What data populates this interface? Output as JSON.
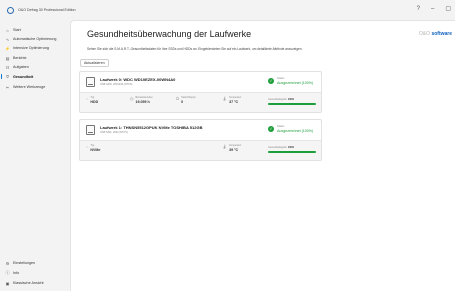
{
  "window": {
    "title": "O&O Defrag 30 Professional Edition",
    "controls": {
      "help": "?",
      "minimize": "–",
      "restore": "▢"
    }
  },
  "sidebar": {
    "items": [
      {
        "label": "Start",
        "icon": "home-icon",
        "glyph": "⌂",
        "active": false
      },
      {
        "label": "Automatische Optimierung",
        "icon": "wave-icon",
        "glyph": "∿",
        "active": false
      },
      {
        "label": "Intensive Optimierung",
        "icon": "lightning-icon",
        "glyph": "⚡",
        "active": false
      },
      {
        "label": "Berichte",
        "icon": "chart-icon",
        "glyph": "▤",
        "active": false
      },
      {
        "label": "Aufgaben",
        "icon": "clipboard-icon",
        "glyph": "☷",
        "active": false
      },
      {
        "label": "Gesundheit",
        "icon": "heart-pulse-icon",
        "glyph": "♡",
        "active": true
      },
      {
        "label": "Weitere Werkzeuge",
        "icon": "tools-icon",
        "glyph": "✂",
        "active": false
      }
    ],
    "bottom_items": [
      {
        "label": "Einstellungen",
        "icon": "gear-icon",
        "glyph": "⚙"
      },
      {
        "label": "Info",
        "icon": "info-icon",
        "glyph": "ⓘ"
      },
      {
        "label": "Klassische Ansicht",
        "icon": "classic-view-icon",
        "glyph": "▣"
      }
    ]
  },
  "main": {
    "title": "Gesundheitsüberwachung der Laufwerke",
    "brand_prefix": "O&O",
    "brand_name": "software",
    "description": "Sehen Sie sich die S.M.A.R.T.-Gesundheitsdaten für Ihre SSDs und HDDs an. Eingeblendeten Sie auf ein Laufwerk, um detaillierte Attribute anzuzeigen.",
    "refresh_label": "Aktualisieren"
  },
  "drives": [
    {
      "name": "Laufwerk 0: WDC WD10EZEX-00WN4A0",
      "sub": "USB HDD, WD1234 (NTFS)",
      "status_label": "Status",
      "status_value": "Ausgezeichnet (100%)",
      "metrics": [
        {
          "label": "Typ",
          "value": "HDD",
          "icon": "disk-type-icon"
        },
        {
          "label": "Betriebsstunden",
          "value": "19.059 h",
          "icon": "clock-icon"
        },
        {
          "label": "Starts/Stopps",
          "value": "0",
          "icon": "power-icon"
        },
        {
          "label": "Temperatur",
          "value": "37 °C",
          "icon": "thermometer-icon"
        }
      ],
      "health_label": "Gesundheitsgrad:",
      "health_value": "100%",
      "health_percent": 100
    },
    {
      "name": "Laufwerk 1: THNSN5512GPUK NVMe TOSHIBA 512GB",
      "sub": "USB SSD, 2022 (NTFS)",
      "status_label": "Status",
      "status_value": "Ausgezeichnet (100%)",
      "metrics": [
        {
          "label": "Typ",
          "value": "NVMe",
          "icon": "disk-type-icon"
        },
        {
          "label": "Temperatur",
          "value": "39 °C",
          "icon": "thermometer-icon"
        }
      ],
      "health_label": "Gesundheitsgrad:",
      "health_value": "100%",
      "health_percent": 100
    }
  ],
  "colors": {
    "accent": "#0078d4",
    "good": "#1e9e3a",
    "brand": "#1565c0"
  }
}
